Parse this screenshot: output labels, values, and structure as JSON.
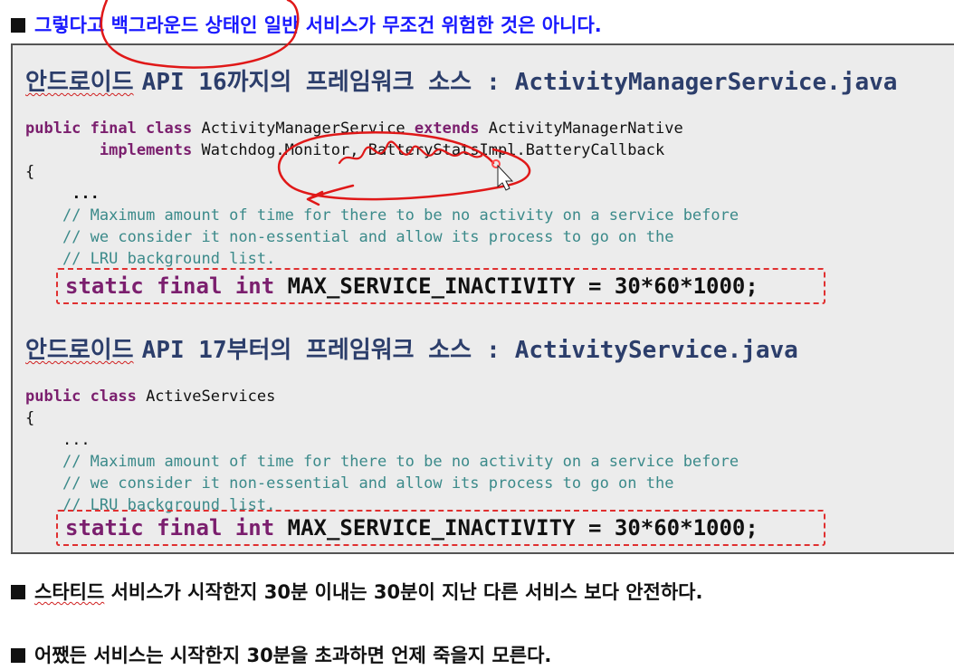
{
  "headline": "그렇다고 백그라운드 상태인 일반 서비스가 무조건 위험한  것은 아니다.",
  "section1": {
    "title_kr": "안드로이드",
    "title_api": "API 16까지의 프레임워크 소스",
    "title_colon": ":",
    "title_file": "ActivityManagerService.java",
    "code": {
      "l1_kw": "public final class",
      "l1_rest": " ActivityManagerService ",
      "l1_kw2": "extends",
      "l1_rest2": " ActivityManagerNative",
      "l2_kw": "implements",
      "l2_rest": " Watchdog.Monitor, BatteryStatsImpl.BatteryCallback",
      "l3": "{",
      "l4": "...",
      "c1": "// Maximum amount of time for there to be no activity on a service before",
      "c2": "// we consider it non-essential and allow its process to go on the",
      "c3": "// LRU background list."
    },
    "decl_kw": "static final int",
    "decl_rest": " MAX_SERVICE_INACTIVITY = 30*60*1000;"
  },
  "section2": {
    "title_kr": "안드로이드",
    "title_api": "API 17부터의 프레임워크 소스",
    "title_colon": ":",
    "title_file": "ActivityService.java",
    "code": {
      "l1_kw": "public class",
      "l1_rest": " ActiveServices",
      "l2": "{",
      "l3": "...",
      "c1": "// Maximum amount of time for there to be no activity on a service before",
      "c2": "// we consider it non-essential and allow its process to go on the",
      "c3": "// LRU background list."
    },
    "decl_kw": "static final int",
    "decl_rest": " MAX_SERVICE_INACTIVITY = 30*60*1000;"
  },
  "note1": "스타티드 서비스가 시작한지 30분 이내는 30분이 지난 다른 서비스 보다 안전하다.",
  "note1_prefix": "스타티드",
  "note1_rest": " 서비스가 시작한지 30분 이내는 30분이 지난 다른 서비스 보다 안전하다.",
  "note2": "어쨌든 서비스는 시작한지 30분을 초과하면 언제 죽을지 모른다.",
  "colors": {
    "headline": "#1a1aff",
    "keyword": "#7b1f6e",
    "comment": "#3b8a8a",
    "title": "#2c3e6b",
    "highlight": "#e03030"
  }
}
